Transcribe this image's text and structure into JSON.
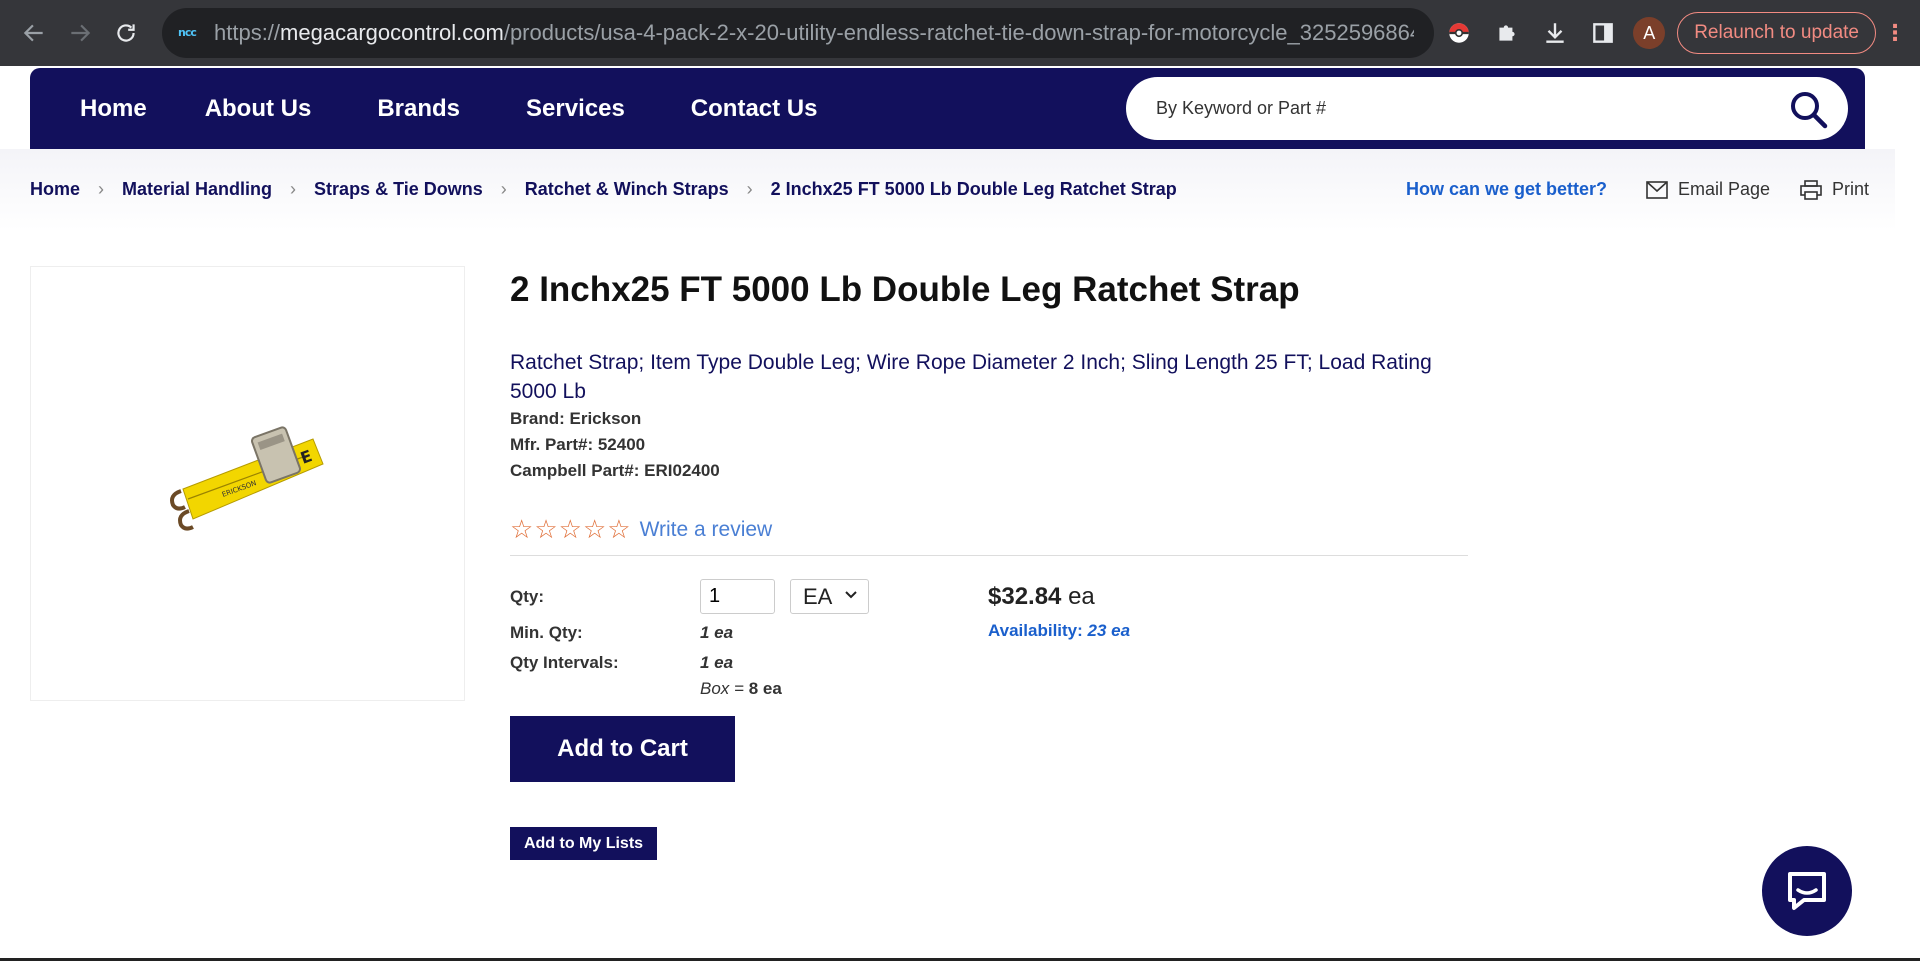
{
  "browser": {
    "url_prefix": "https://",
    "url_host": "megacargocontrol.com",
    "url_path": "/products/usa-4-pack-2-x-20-utility-endless-ratchet-tie-down-strap-for-motorcycle_3252596864...",
    "site_icon_text": "ncc",
    "avatar_letter": "A",
    "relaunch_label": "Relaunch to update"
  },
  "nav": {
    "items": [
      "Home",
      "About Us",
      "Brands",
      "Services",
      "Contact Us"
    ],
    "search_placeholder": "By Keyword or Part #"
  },
  "breadcrumb": {
    "items": [
      "Home",
      "Material Handling",
      "Straps & Tie Downs",
      "Ratchet & Winch Straps",
      "2 Inchx25 FT 5000 Lb Double Leg Ratchet Strap"
    ],
    "feedback": "How can we get better?",
    "email": "Email Page",
    "print": "Print"
  },
  "product": {
    "title": "2 Inchx25 FT 5000 Lb Double Leg Ratchet Strap",
    "description": "Ratchet Strap; Item Type Double Leg; Wire Rope Diameter 2 Inch; Sling Length 25 FT; Load Rating 5000 Lb",
    "brand": "Brand: Erickson",
    "mfr_part": "Mfr. Part#: 52400",
    "campbell_part": "Campbell Part#: ERI02400",
    "rating": 0,
    "rating_max": 5,
    "review_link": "Write a review",
    "qty_label": "Qty:",
    "qty_value": "1",
    "uom": "EA",
    "min_qty_label": "Min. Qty:",
    "min_qty_value": "1 ea",
    "intervals_label": "Qty Intervals:",
    "intervals_value": "1 ea",
    "box_prefix": "Box =",
    "box_value": "8 ea",
    "price": "$32.84",
    "price_unit": "ea",
    "availability_label": "Availability:",
    "availability_value": "23 ea",
    "add_to_cart": "Add to Cart",
    "add_to_lists": "Add to My Lists"
  },
  "colors": {
    "brand_navy": "#12105c",
    "link_blue": "#1a5fcc",
    "star_orange": "#e0703a"
  }
}
